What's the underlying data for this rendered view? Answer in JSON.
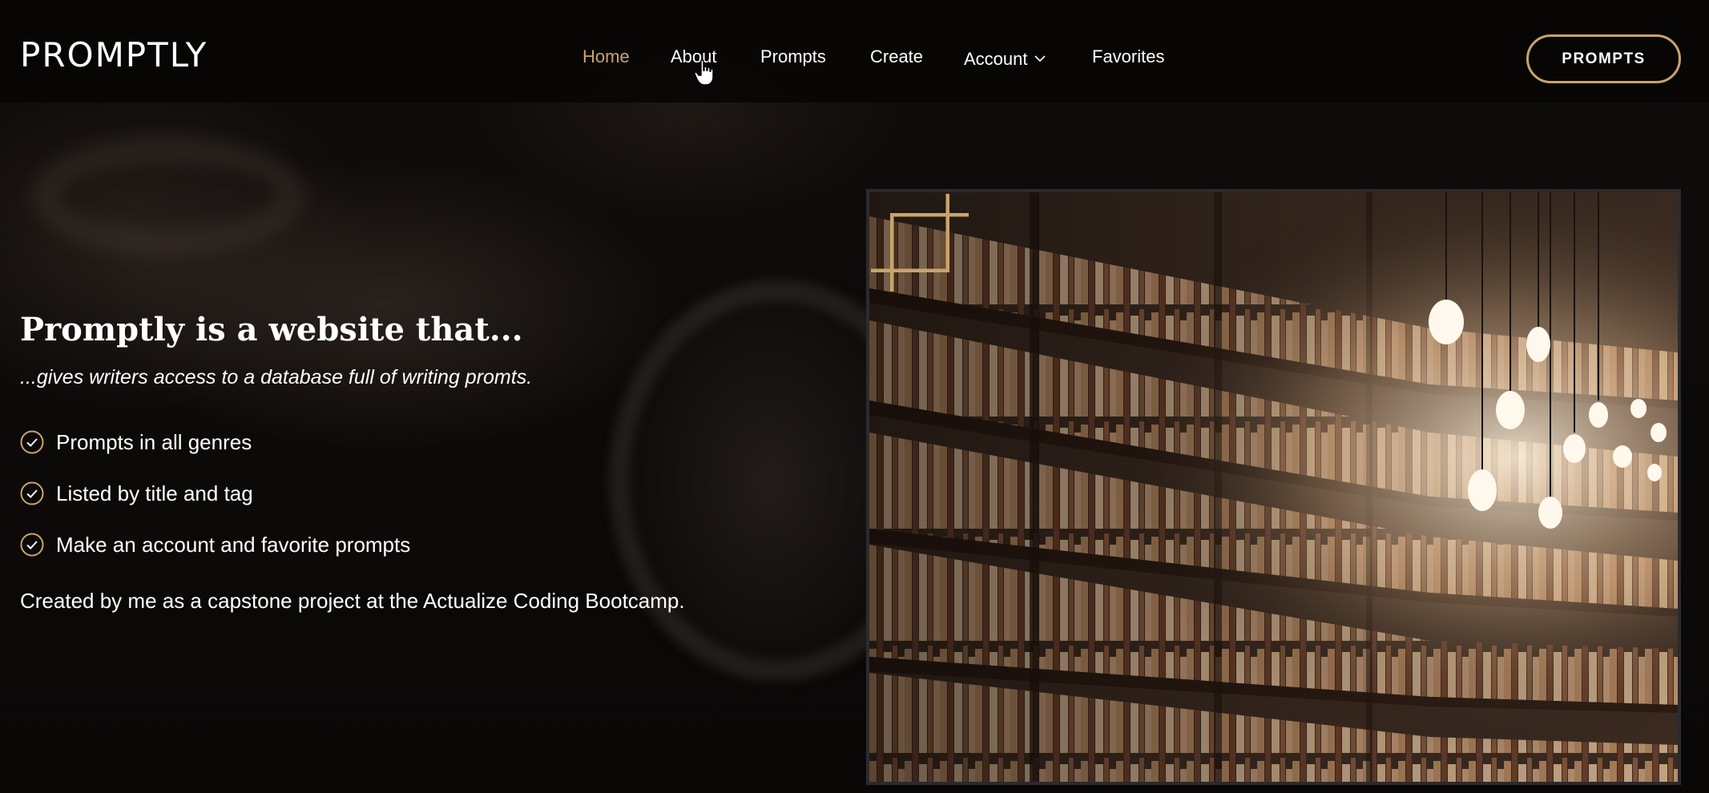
{
  "header": {
    "logo": "PROMPTLY",
    "nav": [
      {
        "label": "Home",
        "active": true
      },
      {
        "label": "About",
        "active": false
      },
      {
        "label": "Prompts",
        "active": false
      },
      {
        "label": "Create",
        "active": false
      },
      {
        "label": "Account",
        "active": false,
        "has_dropdown": true
      },
      {
        "label": "Favorites",
        "active": false
      }
    ],
    "cta_label": "PROMPTS"
  },
  "hero": {
    "title": "Promptly is a website that...",
    "subtitle": "...gives writers access to a database full of writing promts.",
    "features": [
      "Prompts in all genres",
      "Listed by title and tag",
      "Make an account and favorite prompts"
    ],
    "credit": "Created by me as a capstone project at the Actualize Coding Bootcamp."
  },
  "image": {
    "subject": "library bookshelves with hanging light bulbs"
  },
  "colors": {
    "accent": "#c9a46a",
    "background": "#0b0908",
    "text": "#ffffff"
  },
  "icons": {
    "feature_bullet": "check-circle-icon",
    "dropdown": "chevron-down-icon",
    "cursor": "hand-pointer-icon"
  }
}
